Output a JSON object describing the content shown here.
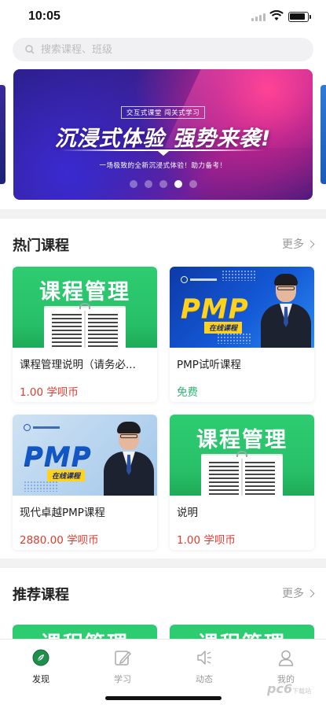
{
  "status_bar": {
    "time": "10:05"
  },
  "search": {
    "placeholder": "搜索课程、班级",
    "icon": "search-icon"
  },
  "banner": {
    "tags": "交互式课堂  闯关式学习",
    "headline": "沉浸式体验  强势来袭!",
    "subline": "一场极致的全新沉浸式体验！助力备考！",
    "slide_count": 5,
    "active_slide": 4
  },
  "hot_courses": {
    "title": "热门课程",
    "more": "更多",
    "cards": [
      {
        "thumb_text": "课程管理",
        "title": "课程管理说明（请务必...",
        "price": "1.00 学呗币"
      },
      {
        "thumb_text": "PMP",
        "thumb_badge": "在线课程",
        "title": "PMP试听课程",
        "price": "免费"
      },
      {
        "thumb_text": "PMP",
        "thumb_badge": "在线课程",
        "title": "现代卓越PMP课程",
        "price": "2880.00 学呗币"
      },
      {
        "thumb_text": "课程管理",
        "title": "说明",
        "price": "1.00 学呗币"
      }
    ]
  },
  "recommended": {
    "title": "推荐课程",
    "more": "更多",
    "cards": [
      {
        "thumb_text": "课程管理"
      },
      {
        "thumb_text": "课程管理"
      }
    ]
  },
  "tabbar": {
    "items": [
      {
        "label": "发现",
        "icon": "discover-icon",
        "active": true
      },
      {
        "label": "学习",
        "icon": "study-icon",
        "active": false
      },
      {
        "label": "动态",
        "icon": "news-icon",
        "active": false
      },
      {
        "label": "我的",
        "icon": "profile-icon",
        "active": false
      }
    ]
  },
  "watermark": {
    "brand": "pc6",
    "suffix": "下载站"
  },
  "colors": {
    "accent_green": "#2ecc71",
    "price_red": "#e03a2f",
    "free_green": "#2bb673",
    "pmp_yellow": "#ffd21e"
  }
}
